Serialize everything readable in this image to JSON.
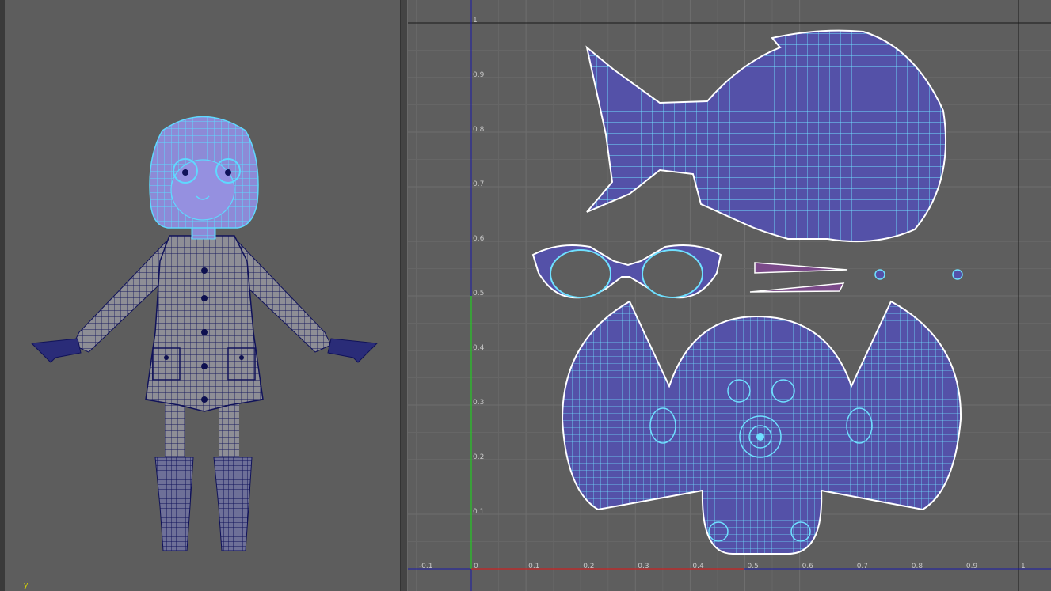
{
  "viewport_persp": {
    "axis_indicator": "y",
    "model": "girl-character-wireframe"
  },
  "uv_editor": {
    "x_ticks": [
      "-0.1",
      "0",
      "0.1",
      "0.2",
      "0.3",
      "0.4",
      "0.5",
      "0.6",
      "0.7",
      "0.8",
      "0.9",
      "1"
    ],
    "y_ticks": [
      "1",
      "0.9",
      "0.8",
      "0.7",
      "0.6",
      "0.5",
      "0.4",
      "0.3",
      "0.2",
      "0.1"
    ],
    "shells": [
      "hair-back-shell",
      "glasses-shell",
      "lens-strip-shell-1",
      "lens-strip-shell-2",
      "eye-shell-left",
      "eye-shell-right",
      "face-shell"
    ]
  },
  "colors": {
    "background": "#5e5e5e",
    "grid": "#6b6b6b",
    "uv_fill": "#5451a8",
    "uv_wire": "#6fe0ff",
    "uv_border": "#ffffff",
    "x_axis": "#cc2222",
    "y_axis": "#22cc22",
    "model_wire": "#10125a",
    "selected_wire": "#5fd8ff"
  }
}
